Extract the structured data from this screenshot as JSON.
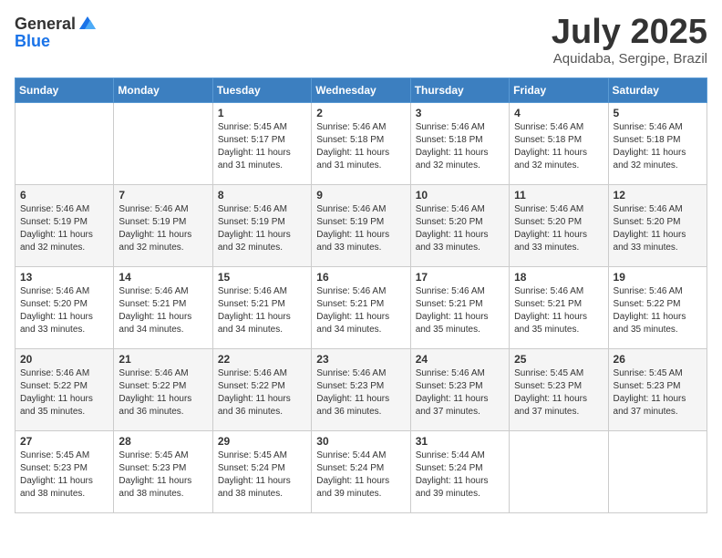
{
  "header": {
    "logo_general": "General",
    "logo_blue": "Blue",
    "month": "July 2025",
    "location": "Aquidaba, Sergipe, Brazil"
  },
  "weekdays": [
    "Sunday",
    "Monday",
    "Tuesday",
    "Wednesday",
    "Thursday",
    "Friday",
    "Saturday"
  ],
  "weeks": [
    [
      {
        "day": "",
        "sunrise": "",
        "sunset": "",
        "daylight": ""
      },
      {
        "day": "",
        "sunrise": "",
        "sunset": "",
        "daylight": ""
      },
      {
        "day": "1",
        "sunrise": "Sunrise: 5:45 AM",
        "sunset": "Sunset: 5:17 PM",
        "daylight": "Daylight: 11 hours and 31 minutes."
      },
      {
        "day": "2",
        "sunrise": "Sunrise: 5:46 AM",
        "sunset": "Sunset: 5:18 PM",
        "daylight": "Daylight: 11 hours and 31 minutes."
      },
      {
        "day": "3",
        "sunrise": "Sunrise: 5:46 AM",
        "sunset": "Sunset: 5:18 PM",
        "daylight": "Daylight: 11 hours and 32 minutes."
      },
      {
        "day": "4",
        "sunrise": "Sunrise: 5:46 AM",
        "sunset": "Sunset: 5:18 PM",
        "daylight": "Daylight: 11 hours and 32 minutes."
      },
      {
        "day": "5",
        "sunrise": "Sunrise: 5:46 AM",
        "sunset": "Sunset: 5:18 PM",
        "daylight": "Daylight: 11 hours and 32 minutes."
      }
    ],
    [
      {
        "day": "6",
        "sunrise": "Sunrise: 5:46 AM",
        "sunset": "Sunset: 5:19 PM",
        "daylight": "Daylight: 11 hours and 32 minutes."
      },
      {
        "day": "7",
        "sunrise": "Sunrise: 5:46 AM",
        "sunset": "Sunset: 5:19 PM",
        "daylight": "Daylight: 11 hours and 32 minutes."
      },
      {
        "day": "8",
        "sunrise": "Sunrise: 5:46 AM",
        "sunset": "Sunset: 5:19 PM",
        "daylight": "Daylight: 11 hours and 32 minutes."
      },
      {
        "day": "9",
        "sunrise": "Sunrise: 5:46 AM",
        "sunset": "Sunset: 5:19 PM",
        "daylight": "Daylight: 11 hours and 33 minutes."
      },
      {
        "day": "10",
        "sunrise": "Sunrise: 5:46 AM",
        "sunset": "Sunset: 5:20 PM",
        "daylight": "Daylight: 11 hours and 33 minutes."
      },
      {
        "day": "11",
        "sunrise": "Sunrise: 5:46 AM",
        "sunset": "Sunset: 5:20 PM",
        "daylight": "Daylight: 11 hours and 33 minutes."
      },
      {
        "day": "12",
        "sunrise": "Sunrise: 5:46 AM",
        "sunset": "Sunset: 5:20 PM",
        "daylight": "Daylight: 11 hours and 33 minutes."
      }
    ],
    [
      {
        "day": "13",
        "sunrise": "Sunrise: 5:46 AM",
        "sunset": "Sunset: 5:20 PM",
        "daylight": "Daylight: 11 hours and 33 minutes."
      },
      {
        "day": "14",
        "sunrise": "Sunrise: 5:46 AM",
        "sunset": "Sunset: 5:21 PM",
        "daylight": "Daylight: 11 hours and 34 minutes."
      },
      {
        "day": "15",
        "sunrise": "Sunrise: 5:46 AM",
        "sunset": "Sunset: 5:21 PM",
        "daylight": "Daylight: 11 hours and 34 minutes."
      },
      {
        "day": "16",
        "sunrise": "Sunrise: 5:46 AM",
        "sunset": "Sunset: 5:21 PM",
        "daylight": "Daylight: 11 hours and 34 minutes."
      },
      {
        "day": "17",
        "sunrise": "Sunrise: 5:46 AM",
        "sunset": "Sunset: 5:21 PM",
        "daylight": "Daylight: 11 hours and 35 minutes."
      },
      {
        "day": "18",
        "sunrise": "Sunrise: 5:46 AM",
        "sunset": "Sunset: 5:21 PM",
        "daylight": "Daylight: 11 hours and 35 minutes."
      },
      {
        "day": "19",
        "sunrise": "Sunrise: 5:46 AM",
        "sunset": "Sunset: 5:22 PM",
        "daylight": "Daylight: 11 hours and 35 minutes."
      }
    ],
    [
      {
        "day": "20",
        "sunrise": "Sunrise: 5:46 AM",
        "sunset": "Sunset: 5:22 PM",
        "daylight": "Daylight: 11 hours and 35 minutes."
      },
      {
        "day": "21",
        "sunrise": "Sunrise: 5:46 AM",
        "sunset": "Sunset: 5:22 PM",
        "daylight": "Daylight: 11 hours and 36 minutes."
      },
      {
        "day": "22",
        "sunrise": "Sunrise: 5:46 AM",
        "sunset": "Sunset: 5:22 PM",
        "daylight": "Daylight: 11 hours and 36 minutes."
      },
      {
        "day": "23",
        "sunrise": "Sunrise: 5:46 AM",
        "sunset": "Sunset: 5:23 PM",
        "daylight": "Daylight: 11 hours and 36 minutes."
      },
      {
        "day": "24",
        "sunrise": "Sunrise: 5:46 AM",
        "sunset": "Sunset: 5:23 PM",
        "daylight": "Daylight: 11 hours and 37 minutes."
      },
      {
        "day": "25",
        "sunrise": "Sunrise: 5:45 AM",
        "sunset": "Sunset: 5:23 PM",
        "daylight": "Daylight: 11 hours and 37 minutes."
      },
      {
        "day": "26",
        "sunrise": "Sunrise: 5:45 AM",
        "sunset": "Sunset: 5:23 PM",
        "daylight": "Daylight: 11 hours and 37 minutes."
      }
    ],
    [
      {
        "day": "27",
        "sunrise": "Sunrise: 5:45 AM",
        "sunset": "Sunset: 5:23 PM",
        "daylight": "Daylight: 11 hours and 38 minutes."
      },
      {
        "day": "28",
        "sunrise": "Sunrise: 5:45 AM",
        "sunset": "Sunset: 5:23 PM",
        "daylight": "Daylight: 11 hours and 38 minutes."
      },
      {
        "day": "29",
        "sunrise": "Sunrise: 5:45 AM",
        "sunset": "Sunset: 5:24 PM",
        "daylight": "Daylight: 11 hours and 38 minutes."
      },
      {
        "day": "30",
        "sunrise": "Sunrise: 5:44 AM",
        "sunset": "Sunset: 5:24 PM",
        "daylight": "Daylight: 11 hours and 39 minutes."
      },
      {
        "day": "31",
        "sunrise": "Sunrise: 5:44 AM",
        "sunset": "Sunset: 5:24 PM",
        "daylight": "Daylight: 11 hours and 39 minutes."
      },
      {
        "day": "",
        "sunrise": "",
        "sunset": "",
        "daylight": ""
      },
      {
        "day": "",
        "sunrise": "",
        "sunset": "",
        "daylight": ""
      }
    ]
  ]
}
